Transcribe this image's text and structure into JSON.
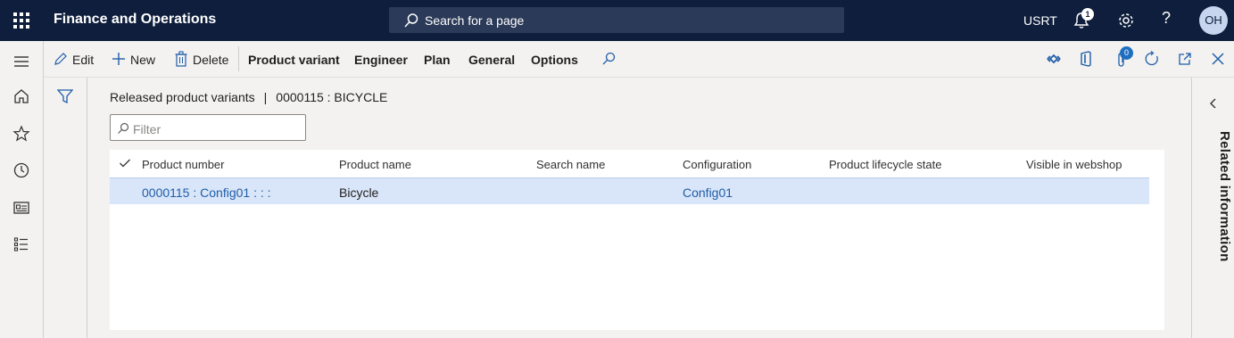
{
  "topbar": {
    "app_title": "Finance and Operations",
    "search_placeholder": "Search for a page",
    "company": "USRT",
    "notification_count": "1",
    "help_label": "?",
    "avatar_initials": "OH"
  },
  "actions": {
    "edit": "Edit",
    "new": "New",
    "delete": "Delete",
    "tabs": [
      "Product variant",
      "Engineer",
      "Plan",
      "General",
      "Options"
    ],
    "attachments_count": "0"
  },
  "page": {
    "caption_left": "Released product variants",
    "caption_sep": "|",
    "caption_right": "0000115 : BICYCLE",
    "filter_placeholder": "Filter"
  },
  "grid": {
    "columns": [
      "Product number",
      "Product name",
      "Search name",
      "Configuration",
      "Product lifecycle state",
      "Visible in webshop"
    ],
    "rows": [
      {
        "product_number": "0000115 : Config01 :  :  :",
        "product_name": "Bicycle",
        "search_name": "",
        "configuration": "Config01",
        "lifecycle_state": "",
        "visible_in_webshop": ""
      }
    ]
  },
  "related": {
    "label": "Related information"
  },
  "colors": {
    "topbar_bg": "#0e1e3c",
    "selected_row": "#d9e5f8",
    "link": "#1f5ea8",
    "accent": "#1f6fc0"
  },
  "icons": [
    "waffle-icon",
    "search-icon",
    "bell-icon",
    "gear-icon",
    "help-icon",
    "hamburger-icon",
    "home-icon",
    "star-icon",
    "clock-icon",
    "workspace-icon",
    "list-icon",
    "pencil-icon",
    "plus-icon",
    "trash-icon",
    "diamond-icon",
    "office-icon",
    "paperclip-icon",
    "refresh-icon",
    "popout-icon",
    "close-icon",
    "filter-icon",
    "chevron-left-icon",
    "checkmark-icon"
  ]
}
